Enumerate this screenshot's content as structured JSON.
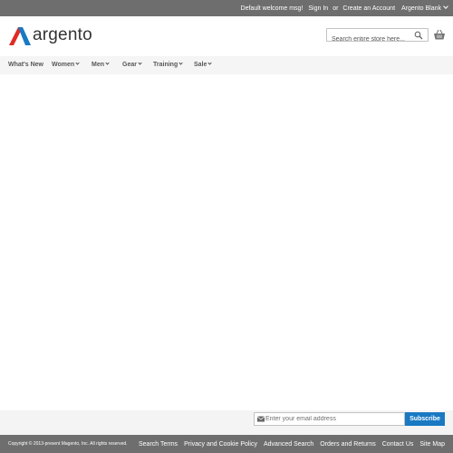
{
  "topbar": {
    "welcome": "Default welcome msg!",
    "sign_in": "Sign In",
    "or": "or",
    "create_account": "Create an Account",
    "store_switcher": "Argento Blank"
  },
  "header": {
    "logo_text": "argento",
    "logo_colors": {
      "left": "#e02b27",
      "right": "#1979c3"
    },
    "search_placeholder": "Search entire store here...",
    "search_icon": "search-icon",
    "cart_icon": "cart-icon"
  },
  "nav": {
    "items": [
      {
        "label": "What's New",
        "has_dropdown": false
      },
      {
        "label": "Women",
        "has_dropdown": true
      },
      {
        "label": "Men",
        "has_dropdown": true
      },
      {
        "label": "Gear",
        "has_dropdown": true
      },
      {
        "label": "Training",
        "has_dropdown": true
      },
      {
        "label": "Sale",
        "has_dropdown": true
      }
    ]
  },
  "footer": {
    "newsletter_placeholder": "Enter your email address",
    "subscribe_label": "Subscribe",
    "subscribe_color": "#1979c3",
    "copyright": "Copyright © 2013-present Magento, Inc. All rights reserved.",
    "links": [
      "Search Terms",
      "Privacy and Cookie Policy",
      "Advanced Search",
      "Orders and Returns",
      "Contact Us",
      "Site Map"
    ]
  }
}
